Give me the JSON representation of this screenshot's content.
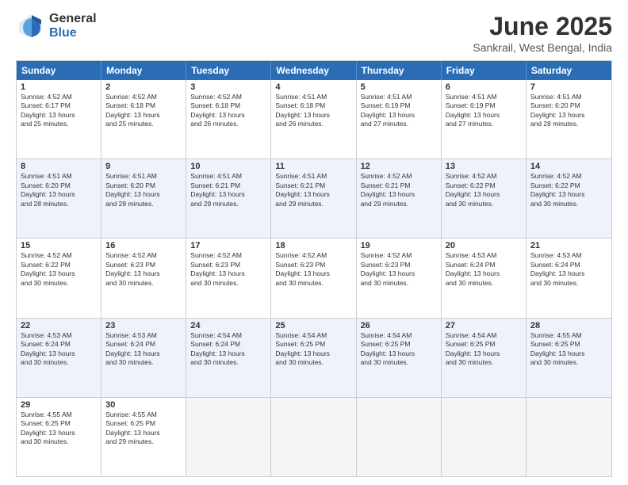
{
  "logo": {
    "general": "General",
    "blue": "Blue"
  },
  "title": "June 2025",
  "location": "Sankrail, West Bengal, India",
  "header_days": [
    "Sunday",
    "Monday",
    "Tuesday",
    "Wednesday",
    "Thursday",
    "Friday",
    "Saturday"
  ],
  "rows": [
    {
      "alt": false,
      "cells": [
        {
          "day": "1",
          "lines": [
            "Sunrise: 4:52 AM",
            "Sunset: 6:17 PM",
            "Daylight: 13 hours",
            "and 25 minutes."
          ]
        },
        {
          "day": "2",
          "lines": [
            "Sunrise: 4:52 AM",
            "Sunset: 6:18 PM",
            "Daylight: 13 hours",
            "and 25 minutes."
          ]
        },
        {
          "day": "3",
          "lines": [
            "Sunrise: 4:52 AM",
            "Sunset: 6:18 PM",
            "Daylight: 13 hours",
            "and 26 minutes."
          ]
        },
        {
          "day": "4",
          "lines": [
            "Sunrise: 4:51 AM",
            "Sunset: 6:18 PM",
            "Daylight: 13 hours",
            "and 26 minutes."
          ]
        },
        {
          "day": "5",
          "lines": [
            "Sunrise: 4:51 AM",
            "Sunset: 6:19 PM",
            "Daylight: 13 hours",
            "and 27 minutes."
          ]
        },
        {
          "day": "6",
          "lines": [
            "Sunrise: 4:51 AM",
            "Sunset: 6:19 PM",
            "Daylight: 13 hours",
            "and 27 minutes."
          ]
        },
        {
          "day": "7",
          "lines": [
            "Sunrise: 4:51 AM",
            "Sunset: 6:20 PM",
            "Daylight: 13 hours",
            "and 28 minutes."
          ]
        }
      ]
    },
    {
      "alt": true,
      "cells": [
        {
          "day": "8",
          "lines": [
            "Sunrise: 4:51 AM",
            "Sunset: 6:20 PM",
            "Daylight: 13 hours",
            "and 28 minutes."
          ]
        },
        {
          "day": "9",
          "lines": [
            "Sunrise: 4:51 AM",
            "Sunset: 6:20 PM",
            "Daylight: 13 hours",
            "and 28 minutes."
          ]
        },
        {
          "day": "10",
          "lines": [
            "Sunrise: 4:51 AM",
            "Sunset: 6:21 PM",
            "Daylight: 13 hours",
            "and 29 minutes."
          ]
        },
        {
          "day": "11",
          "lines": [
            "Sunrise: 4:51 AM",
            "Sunset: 6:21 PM",
            "Daylight: 13 hours",
            "and 29 minutes."
          ]
        },
        {
          "day": "12",
          "lines": [
            "Sunrise: 4:52 AM",
            "Sunset: 6:21 PM",
            "Daylight: 13 hours",
            "and 29 minutes."
          ]
        },
        {
          "day": "13",
          "lines": [
            "Sunrise: 4:52 AM",
            "Sunset: 6:22 PM",
            "Daylight: 13 hours",
            "and 30 minutes."
          ]
        },
        {
          "day": "14",
          "lines": [
            "Sunrise: 4:52 AM",
            "Sunset: 6:22 PM",
            "Daylight: 13 hours",
            "and 30 minutes."
          ]
        }
      ]
    },
    {
      "alt": false,
      "cells": [
        {
          "day": "15",
          "lines": [
            "Sunrise: 4:52 AM",
            "Sunset: 6:22 PM",
            "Daylight: 13 hours",
            "and 30 minutes."
          ]
        },
        {
          "day": "16",
          "lines": [
            "Sunrise: 4:52 AM",
            "Sunset: 6:23 PM",
            "Daylight: 13 hours",
            "and 30 minutes."
          ]
        },
        {
          "day": "17",
          "lines": [
            "Sunrise: 4:52 AM",
            "Sunset: 6:23 PM",
            "Daylight: 13 hours",
            "and 30 minutes."
          ]
        },
        {
          "day": "18",
          "lines": [
            "Sunrise: 4:52 AM",
            "Sunset: 6:23 PM",
            "Daylight: 13 hours",
            "and 30 minutes."
          ]
        },
        {
          "day": "19",
          "lines": [
            "Sunrise: 4:52 AM",
            "Sunset: 6:23 PM",
            "Daylight: 13 hours",
            "and 30 minutes."
          ]
        },
        {
          "day": "20",
          "lines": [
            "Sunrise: 4:53 AM",
            "Sunset: 6:24 PM",
            "Daylight: 13 hours",
            "and 30 minutes."
          ]
        },
        {
          "day": "21",
          "lines": [
            "Sunrise: 4:53 AM",
            "Sunset: 6:24 PM",
            "Daylight: 13 hours",
            "and 30 minutes."
          ]
        }
      ]
    },
    {
      "alt": true,
      "cells": [
        {
          "day": "22",
          "lines": [
            "Sunrise: 4:53 AM",
            "Sunset: 6:24 PM",
            "Daylight: 13 hours",
            "and 30 minutes."
          ]
        },
        {
          "day": "23",
          "lines": [
            "Sunrise: 4:53 AM",
            "Sunset: 6:24 PM",
            "Daylight: 13 hours",
            "and 30 minutes."
          ]
        },
        {
          "day": "24",
          "lines": [
            "Sunrise: 4:54 AM",
            "Sunset: 6:24 PM",
            "Daylight: 13 hours",
            "and 30 minutes."
          ]
        },
        {
          "day": "25",
          "lines": [
            "Sunrise: 4:54 AM",
            "Sunset: 6:25 PM",
            "Daylight: 13 hours",
            "and 30 minutes."
          ]
        },
        {
          "day": "26",
          "lines": [
            "Sunrise: 4:54 AM",
            "Sunset: 6:25 PM",
            "Daylight: 13 hours",
            "and 30 minutes."
          ]
        },
        {
          "day": "27",
          "lines": [
            "Sunrise: 4:54 AM",
            "Sunset: 6:25 PM",
            "Daylight: 13 hours",
            "and 30 minutes."
          ]
        },
        {
          "day": "28",
          "lines": [
            "Sunrise: 4:55 AM",
            "Sunset: 6:25 PM",
            "Daylight: 13 hours",
            "and 30 minutes."
          ]
        }
      ]
    },
    {
      "alt": false,
      "cells": [
        {
          "day": "29",
          "lines": [
            "Sunrise: 4:55 AM",
            "Sunset: 6:25 PM",
            "Daylight: 13 hours",
            "and 30 minutes."
          ]
        },
        {
          "day": "30",
          "lines": [
            "Sunrise: 4:55 AM",
            "Sunset: 6:25 PM",
            "Daylight: 13 hours",
            "and 29 minutes."
          ]
        },
        {
          "day": "",
          "lines": []
        },
        {
          "day": "",
          "lines": []
        },
        {
          "day": "",
          "lines": []
        },
        {
          "day": "",
          "lines": []
        },
        {
          "day": "",
          "lines": []
        }
      ]
    }
  ]
}
